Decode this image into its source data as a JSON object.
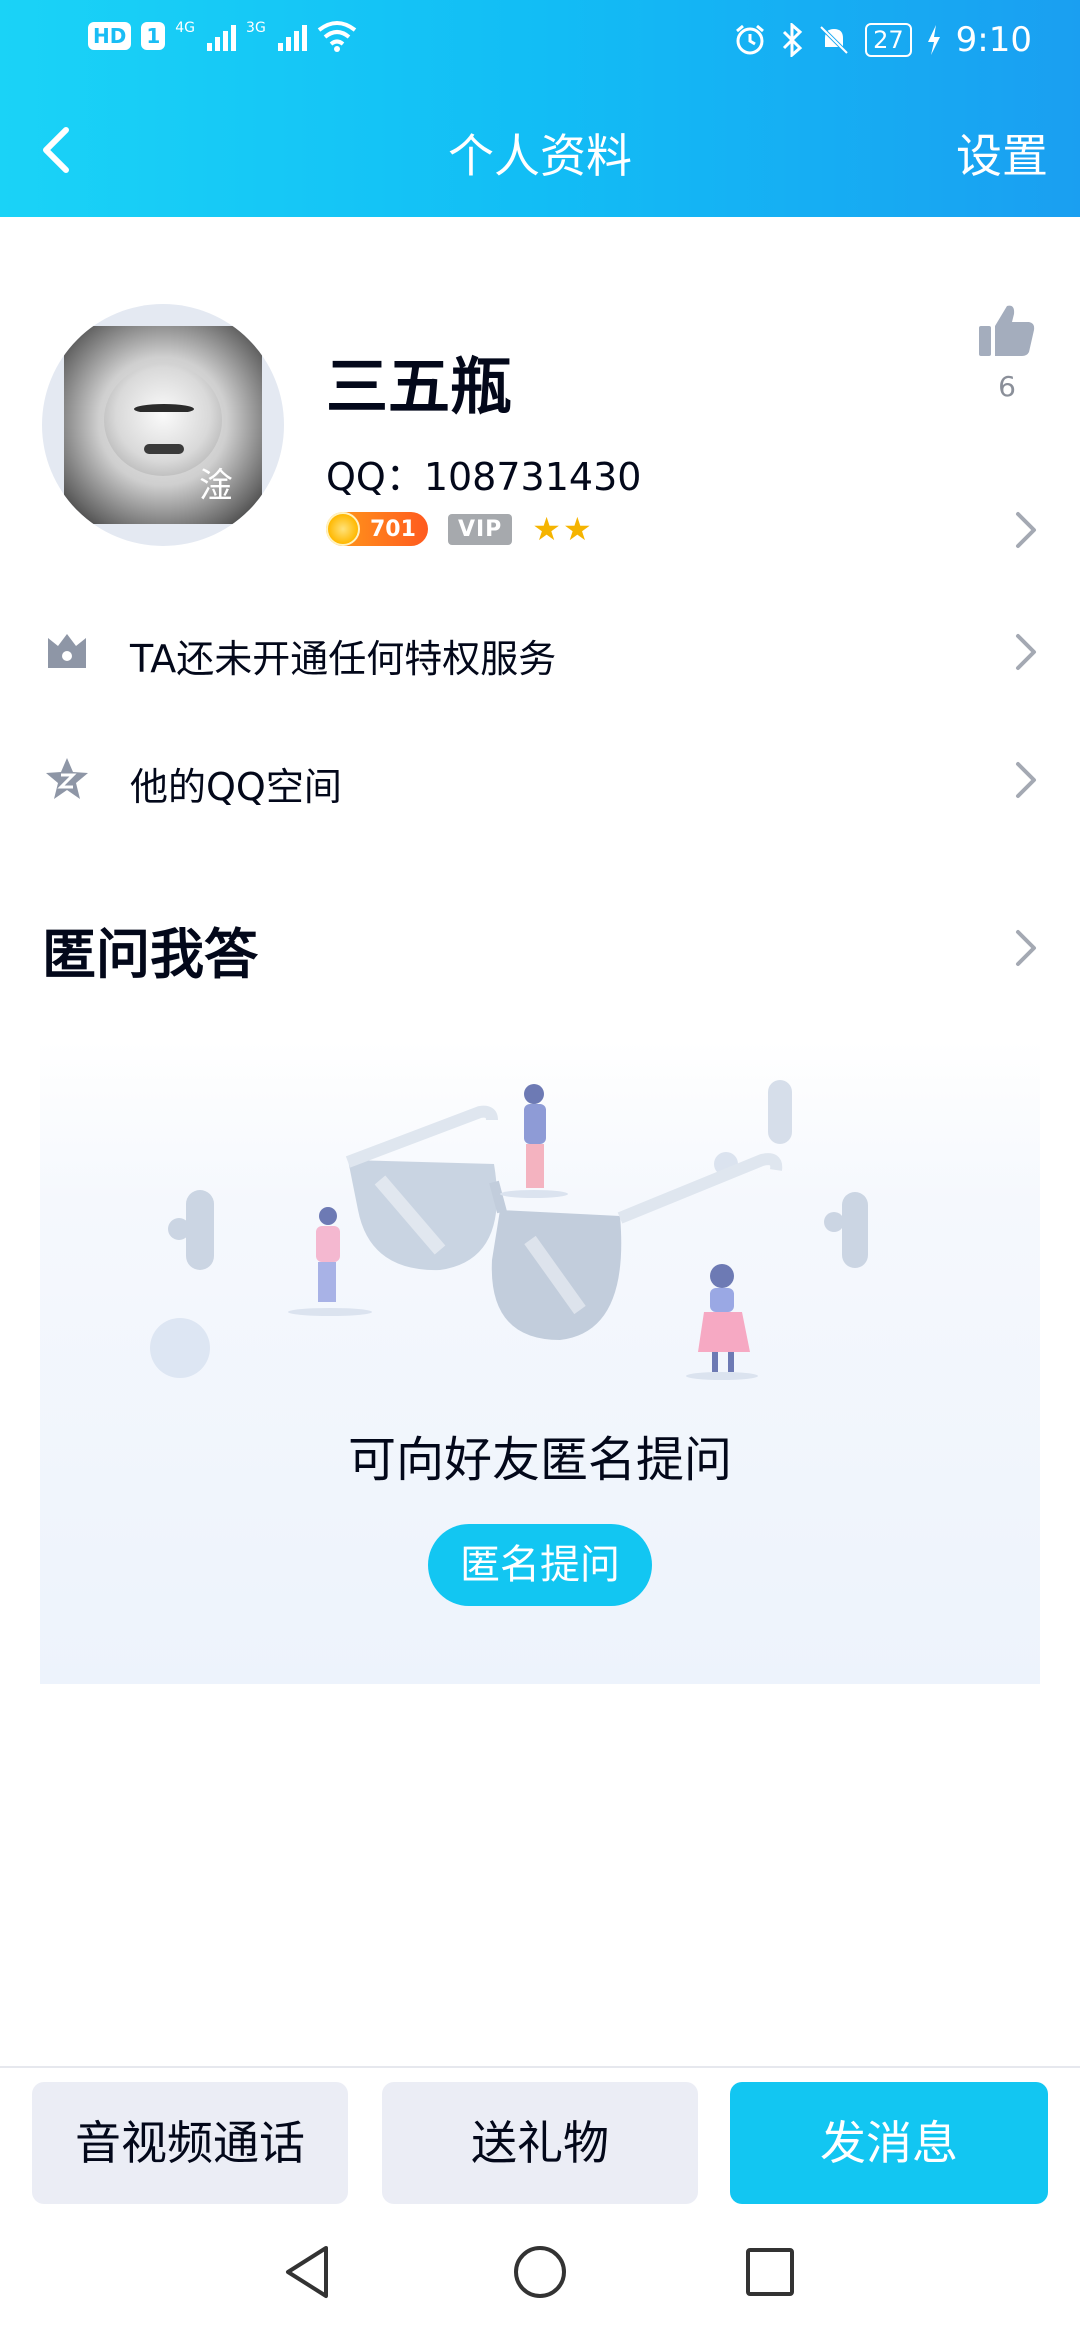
{
  "status_bar": {
    "hd_label": "HD",
    "sim_label": "1",
    "signal1_tag": "4G",
    "signal2_tag": "3G",
    "battery": "27",
    "time": "9:10"
  },
  "nav": {
    "title": "个人资料",
    "settings": "设置"
  },
  "profile": {
    "avatar_overlay_char": "淦",
    "nickname": "三五瓶",
    "qq_label": "QQ：",
    "qq_number": "108731430",
    "coin_level": "701",
    "vip_label": "VIP",
    "stars": 2,
    "like_count": "6"
  },
  "rows": {
    "privilege": "TA还未开通任何特权服务",
    "qzone": "他的QQ空间"
  },
  "qa": {
    "title": "匿问我答",
    "prompt": "可向好友匿名提问",
    "button": "匿名提问"
  },
  "bottom_bar": {
    "call": "音视频通话",
    "gift": "送礼物",
    "message": "发消息"
  },
  "colors": {
    "header_start": "#1ad3f7",
    "header_end": "#1a9ff1",
    "accent": "#12c6f2",
    "secondary_button_bg": "#ebedf5"
  },
  "icons": {
    "back": "chevron-left-icon",
    "like": "thumbs-up-icon",
    "privilege": "crown-shield-icon",
    "qzone": "star-z-icon",
    "chevron": "chevron-right-icon"
  }
}
